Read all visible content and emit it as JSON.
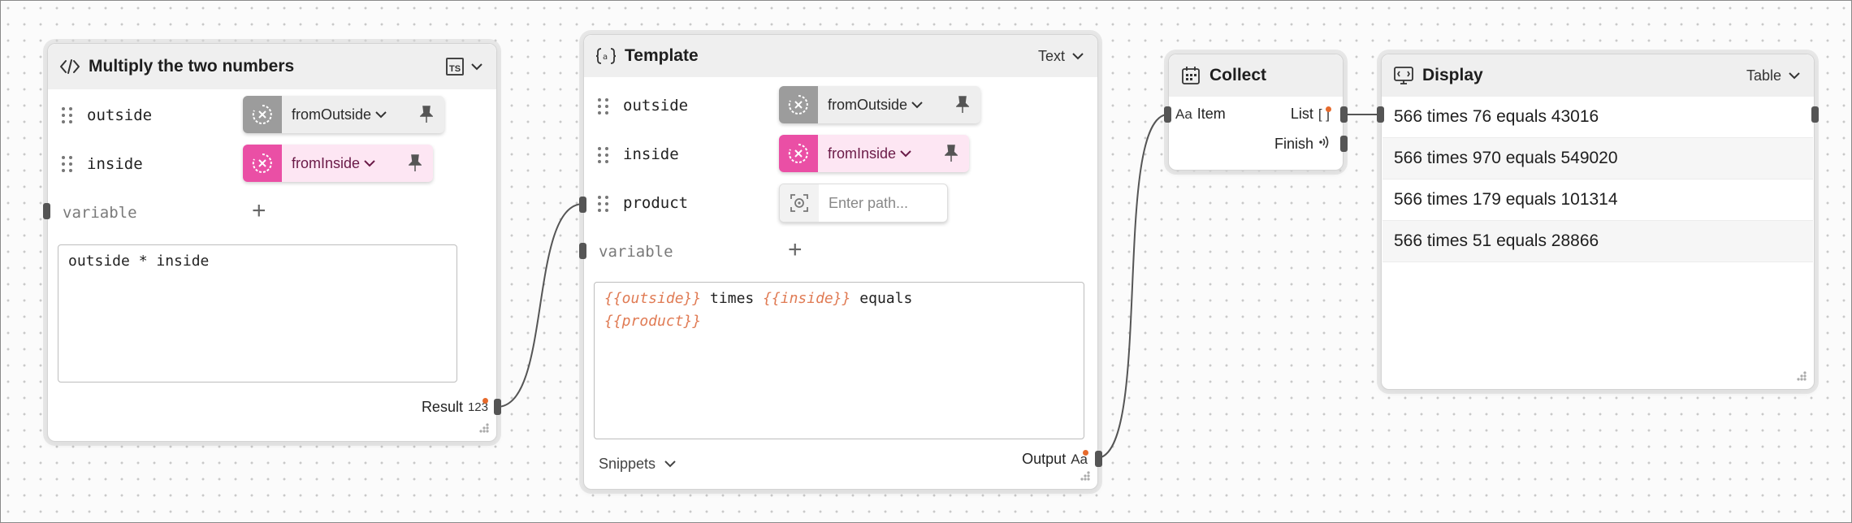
{
  "multiply_node": {
    "title": "Multiply the two numbers",
    "lang_badge": "TS",
    "fields": [
      {
        "name": "outside",
        "source": "fromOutside"
      },
      {
        "name": "inside",
        "source": "fromInside"
      }
    ],
    "variable_placeholder": "variable",
    "code": "outside * inside",
    "output_label": "Result",
    "output_type": "123"
  },
  "template_node": {
    "title": "Template",
    "mode": "Text",
    "fields": [
      {
        "name": "outside",
        "source": "fromOutside"
      },
      {
        "name": "inside",
        "source": "fromInside"
      },
      {
        "name": "product",
        "source_placeholder": "Enter path..."
      }
    ],
    "variable_placeholder": "variable",
    "template_tokens": {
      "outside": "{{outside}}",
      "times": " times ",
      "inside": "{{inside}}",
      "equals": " equals",
      "product": "{{product}}"
    },
    "snippets_label": "Snippets",
    "output_label": "Output",
    "output_type": "Aa"
  },
  "collect_node": {
    "title": "Collect",
    "input_type": "Aa",
    "input_label": "Item",
    "output_label": "List",
    "output_type": "[ ]",
    "finish_label": "Finish"
  },
  "display_node": {
    "title": "Display",
    "mode": "Table",
    "rows": [
      "566 times 76 equals 43016",
      "566 times 970 equals 549020",
      "566 times 179 equals 101314",
      "566 times 51 equals 28866"
    ]
  },
  "colors": {
    "accent_pink": "#ea4fa5",
    "token_orange": "#e07b54",
    "status_dot": "#e66a2c"
  }
}
